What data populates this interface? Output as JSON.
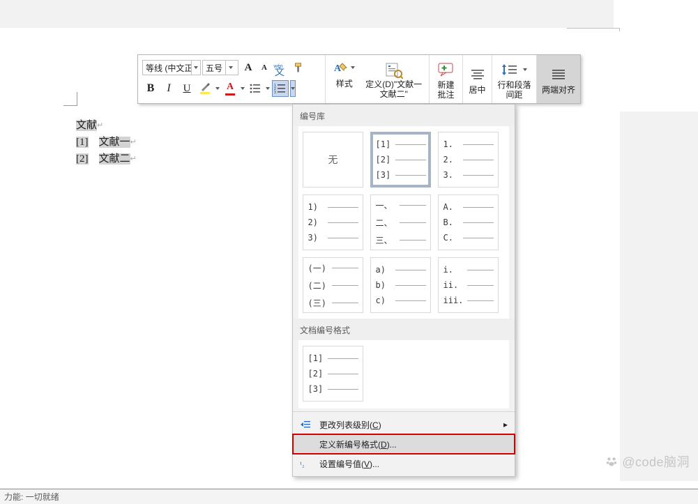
{
  "toolbar": {
    "font_name": "等线 (中文正",
    "font_size": "五号",
    "increase_font_tip": "A",
    "decrease_font_tip": "A",
    "bold": "B",
    "italic": "I",
    "underline": "U",
    "styles_label": "样式",
    "define_label_line1": "定义(D)\"文献一",
    "define_label_line2": "文献二\"",
    "new_comment_line1": "新建",
    "new_comment_line2": "批注",
    "center_label": "居中",
    "spacing_line1": "行和段落",
    "spacing_line2": "间距",
    "justify_label": "两端对齐"
  },
  "document": {
    "heading": "文献",
    "items": [
      {
        "num": "[1]",
        "text": "文献一"
      },
      {
        "num": "[2]",
        "text": "文献二"
      }
    ]
  },
  "num_panel": {
    "library_header": "编号库",
    "none_label": "无",
    "formats": [
      {
        "a": "[1]",
        "b": "[2]",
        "c": "[3]",
        "selected": true
      },
      {
        "a": "1.",
        "b": "2.",
        "c": "3."
      },
      {
        "a": "1)",
        "b": "2)",
        "c": "3)"
      },
      {
        "a": "一、",
        "b": "二、",
        "c": "三、",
        "wide": true
      },
      {
        "a": "A.",
        "b": "B.",
        "c": "C."
      },
      {
        "a": "(一)",
        "b": "(二)",
        "c": "(三)",
        "wide": true
      },
      {
        "a": "a)",
        "b": "b)",
        "c": "c)"
      },
      {
        "a": "i.",
        "b": "ii.",
        "c": "iii.",
        "wide": true
      }
    ],
    "doc_header": "文档编号格式",
    "doc_formats": [
      {
        "a": "[1]",
        "b": "[2]",
        "c": "[3]"
      }
    ],
    "menu": {
      "change_level": "更改列表级别",
      "change_level_key": "C",
      "define_new": "定义新编号格式",
      "define_new_key": "D",
      "set_value": "设置编号值",
      "set_value_key": "V"
    }
  },
  "statusbar": {
    "prefix": "力能:",
    "text": "一切就绪"
  },
  "watermark": "@code脑洞"
}
